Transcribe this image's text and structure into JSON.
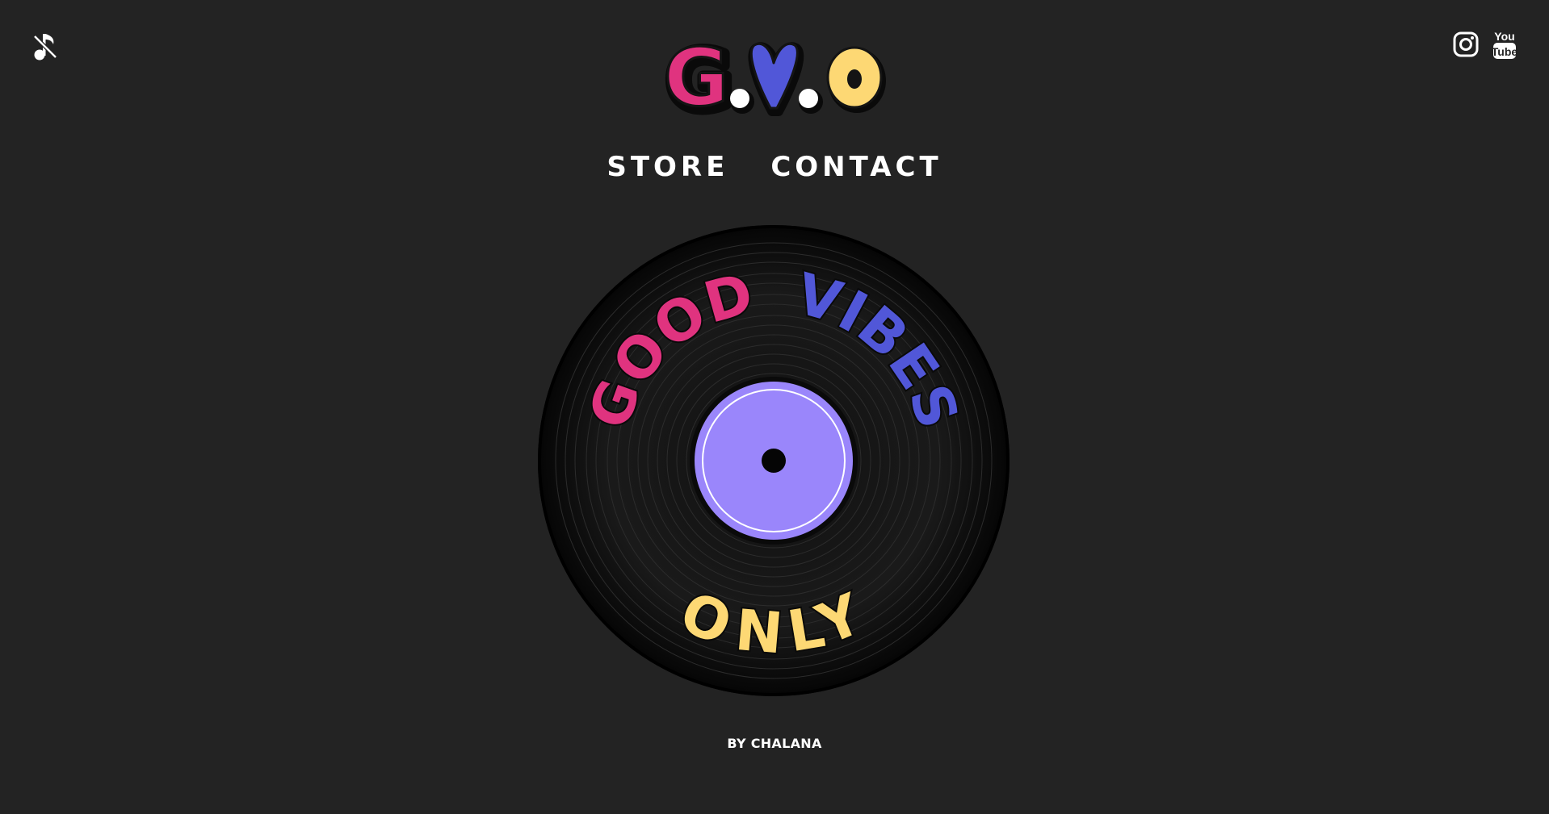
{
  "logo": {
    "letters": [
      "G",
      ".",
      "V",
      ".",
      "O"
    ],
    "colors": {
      "g": "#e0337f",
      "v": "#5157d8",
      "o": "#fdd874",
      "dot": "#ffffff"
    }
  },
  "nav": {
    "items": [
      {
        "label": "STORE"
      },
      {
        "label": "CONTACT"
      }
    ]
  },
  "record": {
    "word_1": "GOOD",
    "word_2": "VIBES",
    "word_3": "ONLY",
    "colors": {
      "word_1": "#e0337f",
      "word_2": "#5157d8",
      "word_3": "#fdd874",
      "label": "#9a86fb",
      "vinyl": "#0d0d0d"
    }
  },
  "footer": {
    "credit": "BY CHALANA"
  },
  "icons": {
    "music_toggle": "music-off-icon",
    "instagram": "instagram-icon",
    "youtube": "youtube-icon"
  }
}
